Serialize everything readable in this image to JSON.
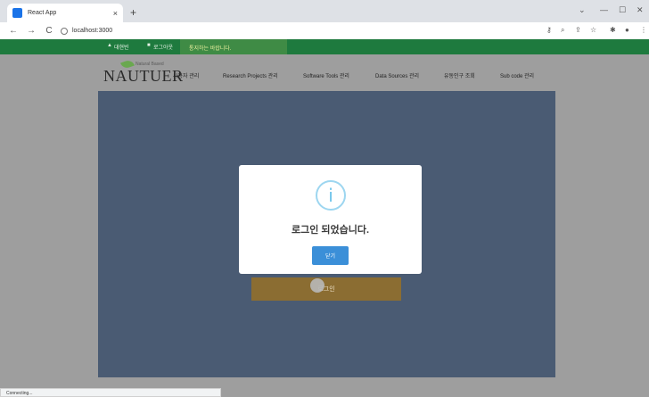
{
  "browser": {
    "tab_title": "React App",
    "tab_close": "×",
    "new_tab": "+",
    "win_min": "—",
    "win_max": "☐",
    "win_close": "✕",
    "win_chevron": "⌄",
    "back": "←",
    "forward": "→",
    "reload": "C",
    "url": "localhost:3000"
  },
  "header": {
    "user_name": "대현빈",
    "logout": "로그아웃",
    "notice": "통지하는 바랍니다."
  },
  "logo": {
    "brand": "NAUTUER",
    "subtitle": "Natural Based"
  },
  "nav": [
    {
      "label": "사용자 관리"
    },
    {
      "label": "Research Projects 관리"
    },
    {
      "label": "Software Tools 관리"
    },
    {
      "label": "Data Sources 관리"
    },
    {
      "label": "유동인구 조회"
    },
    {
      "label": "Sub code 관리"
    }
  ],
  "main": {
    "action_button": "로그인"
  },
  "modal": {
    "icon": "i",
    "message": "로그인 되었습니다.",
    "ok_label": "닫기"
  },
  "status_text": "Connecting..."
}
